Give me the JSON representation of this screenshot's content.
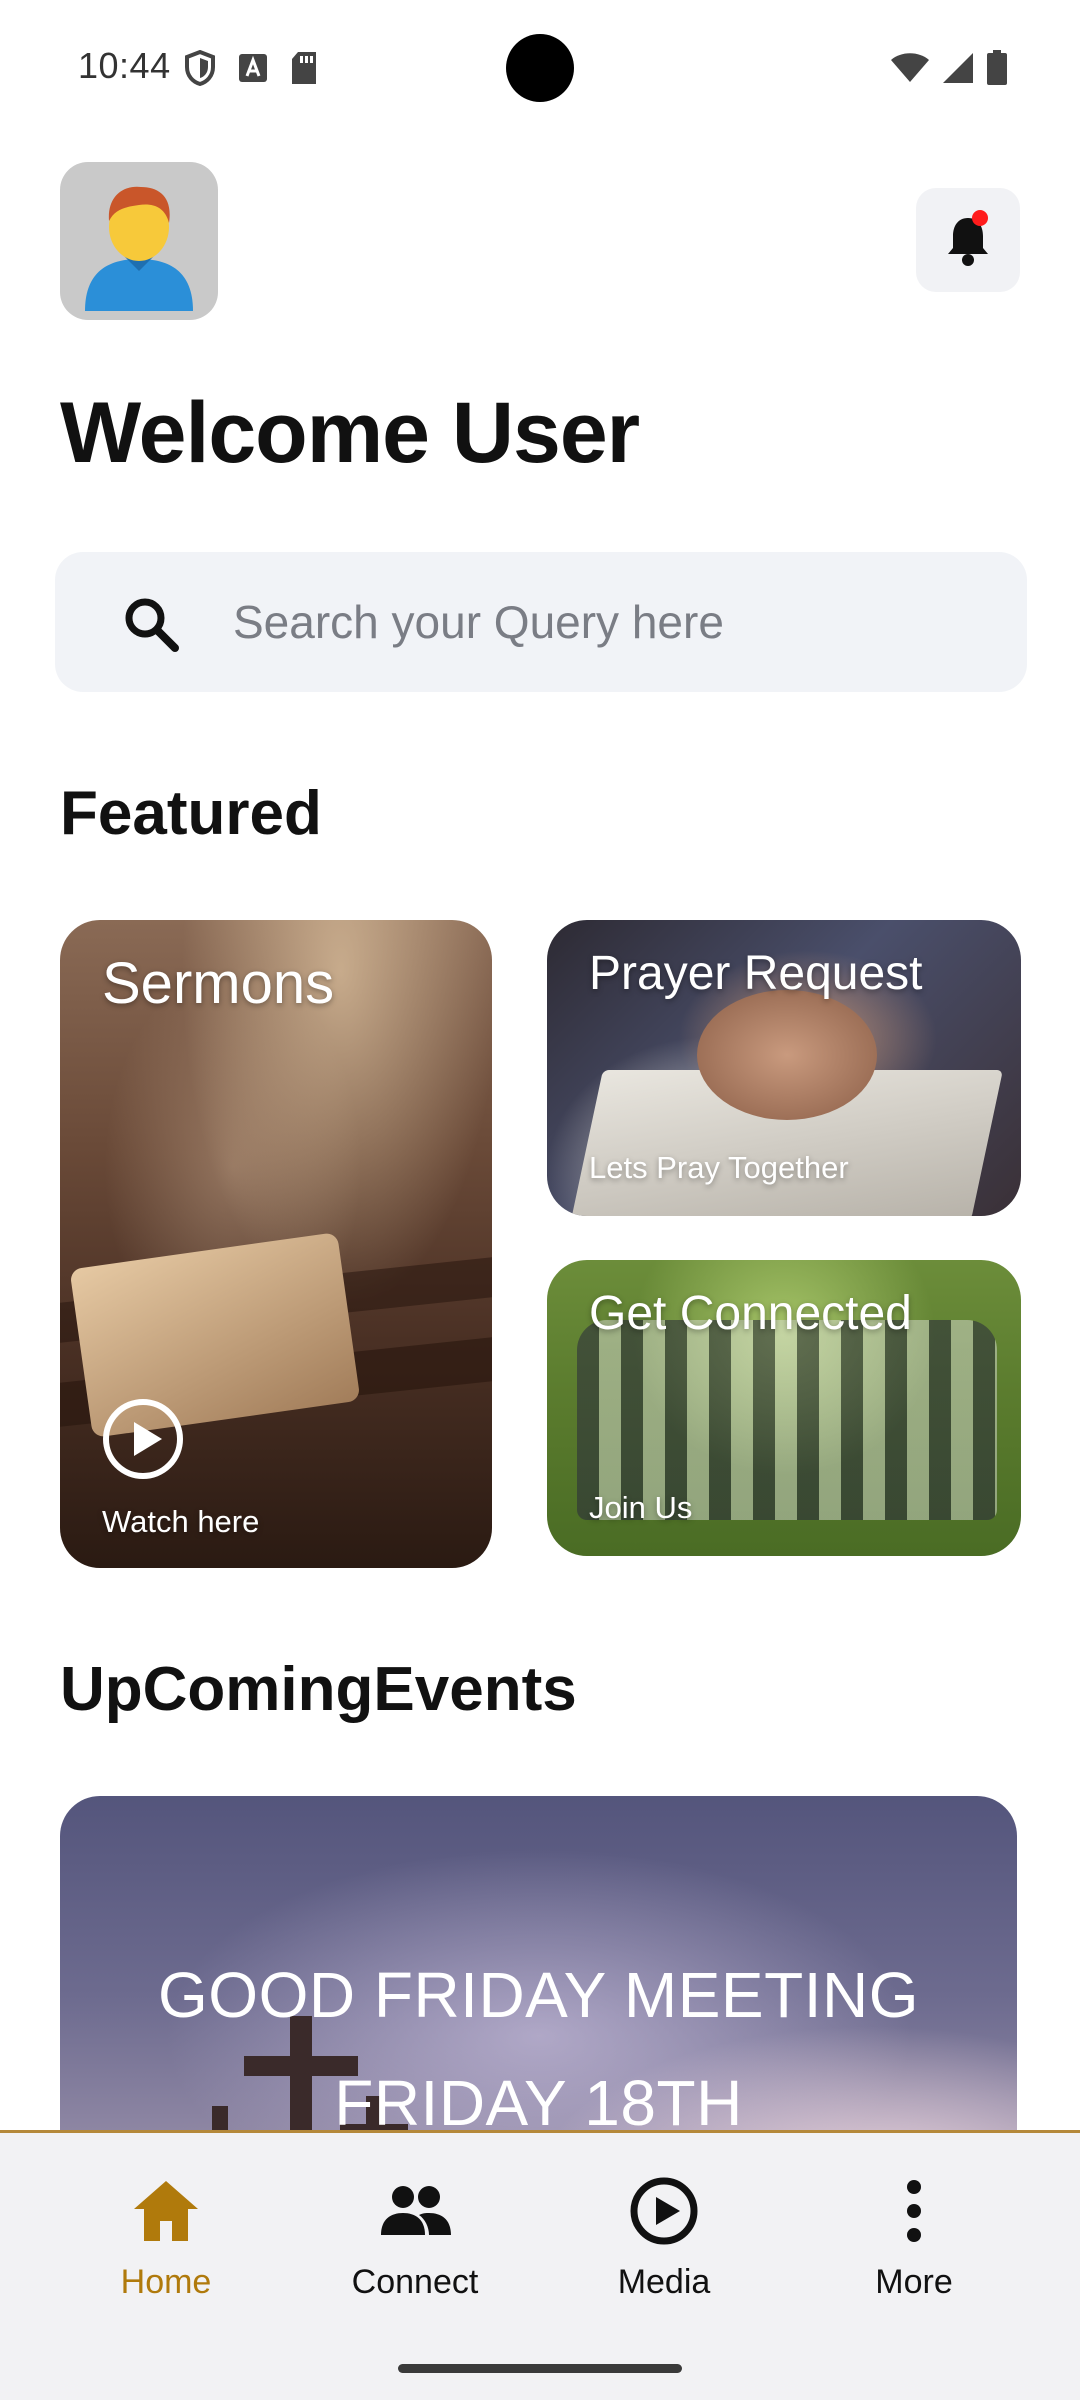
{
  "status_bar": {
    "time": "10:44",
    "icons_left": [
      "shield-icon",
      "font-icon",
      "sd-card-icon"
    ],
    "icons_right": [
      "wifi-icon",
      "signal-icon",
      "battery-icon"
    ]
  },
  "header": {
    "avatar_icon": "user-avatar-icon",
    "notification_icon": "bell-icon",
    "notification_dot_color": "#ff1c1c",
    "welcome_text": "Welcome User"
  },
  "search": {
    "placeholder": "Search your Query here",
    "value": ""
  },
  "featured": {
    "title": "Featured",
    "cards": [
      {
        "title": "Sermons",
        "subtitle": "Watch here",
        "icon": "play-circle-icon"
      },
      {
        "title": "Prayer Request",
        "subtitle": "Lets Pray Together"
      },
      {
        "title": "Get Connected",
        "subtitle": "Join Us"
      }
    ]
  },
  "upcoming": {
    "title": "UpComingEvents",
    "event": {
      "line1": "GOOD FRIDAY MEETING",
      "line2": "FRIDAY 18TH"
    }
  },
  "bottom_nav": {
    "accent_color": "#b07a0c",
    "items": [
      {
        "label": "Home",
        "icon": "home-icon",
        "active": true
      },
      {
        "label": "Connect",
        "icon": "people-icon",
        "active": false
      },
      {
        "label": "Media",
        "icon": "play-circle-icon",
        "active": false
      },
      {
        "label": "More",
        "icon": "more-vertical-icon",
        "active": false
      }
    ]
  }
}
